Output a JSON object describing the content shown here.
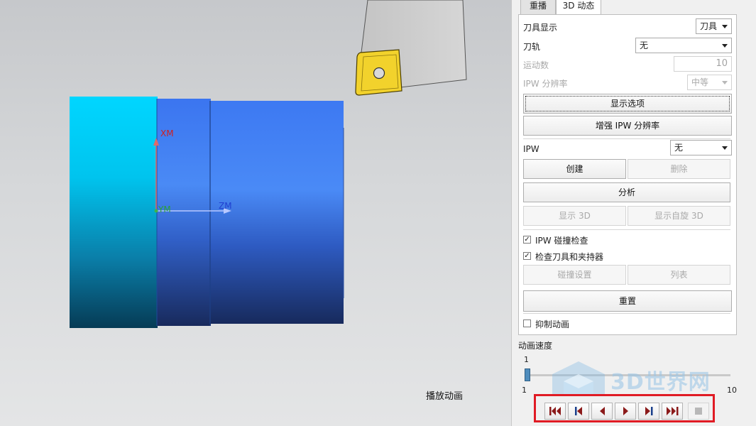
{
  "viewport": {
    "axes": {
      "xm": "XM",
      "ym": "YM",
      "zm": "ZM"
    },
    "caption": "播放动画"
  },
  "tabs": [
    {
      "label": "重播",
      "active": false
    },
    {
      "label": "3D 动态",
      "active": true
    }
  ],
  "panel": {
    "tool_display": {
      "label": "刀具显示",
      "value": "刀具"
    },
    "toolpath": {
      "label": "刀轨",
      "value": "无"
    },
    "motion_count": {
      "label": "运动数",
      "value": "10"
    },
    "ipw_resolution": {
      "label": "IPW 分辨率",
      "value": "中等"
    },
    "display_options_button": "显示选项",
    "enhance_ipw_button": "增强 IPW 分辨率",
    "ipw": {
      "label": "IPW",
      "value": "无"
    },
    "create_button": "创建",
    "delete_button": "删除",
    "analyze_button": "分析",
    "show_3d_button": "显示 3D",
    "show_rotate_3d_button": "显示自旋 3D",
    "ipw_collision_check": {
      "label": "IPW 碰撞检查",
      "checked": true
    },
    "check_tool_holder": {
      "label": "检查刀具和夹持器",
      "checked": true
    },
    "collision_settings_button": "碰撞设置",
    "list_button": "列表",
    "reset_button": "重置",
    "suppress_animation": {
      "label": "抑制动画",
      "checked": false
    }
  },
  "speed": {
    "label": "动画速度",
    "current": "1",
    "min": "1",
    "max": "10",
    "fraction": 0.0
  },
  "transport": [
    "to-start-icon",
    "step-back-icon",
    "play-reverse-icon",
    "play-icon",
    "step-forward-icon",
    "to-end-icon",
    "stop-icon"
  ],
  "watermark": "3D世界网",
  "colors": {
    "highlight_border": "#e01b24",
    "stock_cyan": "#00d2ff",
    "stock_blue": "#3a7cf0",
    "insert_yellow": "#f2d22c"
  }
}
